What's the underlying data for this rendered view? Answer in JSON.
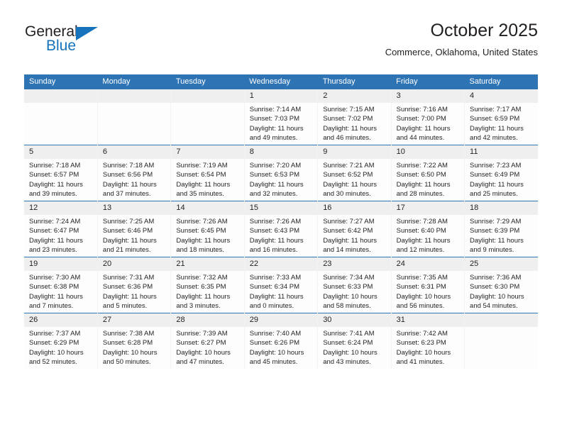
{
  "brand": {
    "name_top": "General",
    "name_bottom": "Blue",
    "triangle_icon": "brand-triangle-icon",
    "accent_color": "#1673bb"
  },
  "header": {
    "title": "October 2025",
    "location": "Commerce, Oklahoma, United States"
  },
  "theme": {
    "header_blue": "#2e74b5",
    "daynum_band": "#efefef",
    "text": "#231f20"
  },
  "calendar": {
    "weekday_headers": [
      "Sunday",
      "Monday",
      "Tuesday",
      "Wednesday",
      "Thursday",
      "Friday",
      "Saturday"
    ],
    "labels": {
      "sunrise": "Sunrise:",
      "sunset": "Sunset:",
      "daylight": "Daylight:"
    },
    "weeks": [
      [
        {
          "day": "",
          "sunrise": "",
          "sunset": "",
          "daylight": ""
        },
        {
          "day": "",
          "sunrise": "",
          "sunset": "",
          "daylight": ""
        },
        {
          "day": "",
          "sunrise": "",
          "sunset": "",
          "daylight": ""
        },
        {
          "day": "1",
          "sunrise": "Sunrise: 7:14 AM",
          "sunset": "Sunset: 7:03 PM",
          "daylight": "Daylight: 11 hours and 49 minutes."
        },
        {
          "day": "2",
          "sunrise": "Sunrise: 7:15 AM",
          "sunset": "Sunset: 7:02 PM",
          "daylight": "Daylight: 11 hours and 46 minutes."
        },
        {
          "day": "3",
          "sunrise": "Sunrise: 7:16 AM",
          "sunset": "Sunset: 7:00 PM",
          "daylight": "Daylight: 11 hours and 44 minutes."
        },
        {
          "day": "4",
          "sunrise": "Sunrise: 7:17 AM",
          "sunset": "Sunset: 6:59 PM",
          "daylight": "Daylight: 11 hours and 42 minutes."
        }
      ],
      [
        {
          "day": "5",
          "sunrise": "Sunrise: 7:18 AM",
          "sunset": "Sunset: 6:57 PM",
          "daylight": "Daylight: 11 hours and 39 minutes."
        },
        {
          "day": "6",
          "sunrise": "Sunrise: 7:18 AM",
          "sunset": "Sunset: 6:56 PM",
          "daylight": "Daylight: 11 hours and 37 minutes."
        },
        {
          "day": "7",
          "sunrise": "Sunrise: 7:19 AM",
          "sunset": "Sunset: 6:54 PM",
          "daylight": "Daylight: 11 hours and 35 minutes."
        },
        {
          "day": "8",
          "sunrise": "Sunrise: 7:20 AM",
          "sunset": "Sunset: 6:53 PM",
          "daylight": "Daylight: 11 hours and 32 minutes."
        },
        {
          "day": "9",
          "sunrise": "Sunrise: 7:21 AM",
          "sunset": "Sunset: 6:52 PM",
          "daylight": "Daylight: 11 hours and 30 minutes."
        },
        {
          "day": "10",
          "sunrise": "Sunrise: 7:22 AM",
          "sunset": "Sunset: 6:50 PM",
          "daylight": "Daylight: 11 hours and 28 minutes."
        },
        {
          "day": "11",
          "sunrise": "Sunrise: 7:23 AM",
          "sunset": "Sunset: 6:49 PM",
          "daylight": "Daylight: 11 hours and 25 minutes."
        }
      ],
      [
        {
          "day": "12",
          "sunrise": "Sunrise: 7:24 AM",
          "sunset": "Sunset: 6:47 PM",
          "daylight": "Daylight: 11 hours and 23 minutes."
        },
        {
          "day": "13",
          "sunrise": "Sunrise: 7:25 AM",
          "sunset": "Sunset: 6:46 PM",
          "daylight": "Daylight: 11 hours and 21 minutes."
        },
        {
          "day": "14",
          "sunrise": "Sunrise: 7:26 AM",
          "sunset": "Sunset: 6:45 PM",
          "daylight": "Daylight: 11 hours and 18 minutes."
        },
        {
          "day": "15",
          "sunrise": "Sunrise: 7:26 AM",
          "sunset": "Sunset: 6:43 PM",
          "daylight": "Daylight: 11 hours and 16 minutes."
        },
        {
          "day": "16",
          "sunrise": "Sunrise: 7:27 AM",
          "sunset": "Sunset: 6:42 PM",
          "daylight": "Daylight: 11 hours and 14 minutes."
        },
        {
          "day": "17",
          "sunrise": "Sunrise: 7:28 AM",
          "sunset": "Sunset: 6:40 PM",
          "daylight": "Daylight: 11 hours and 12 minutes."
        },
        {
          "day": "18",
          "sunrise": "Sunrise: 7:29 AM",
          "sunset": "Sunset: 6:39 PM",
          "daylight": "Daylight: 11 hours and 9 minutes."
        }
      ],
      [
        {
          "day": "19",
          "sunrise": "Sunrise: 7:30 AM",
          "sunset": "Sunset: 6:38 PM",
          "daylight": "Daylight: 11 hours and 7 minutes."
        },
        {
          "day": "20",
          "sunrise": "Sunrise: 7:31 AM",
          "sunset": "Sunset: 6:36 PM",
          "daylight": "Daylight: 11 hours and 5 minutes."
        },
        {
          "day": "21",
          "sunrise": "Sunrise: 7:32 AM",
          "sunset": "Sunset: 6:35 PM",
          "daylight": "Daylight: 11 hours and 3 minutes."
        },
        {
          "day": "22",
          "sunrise": "Sunrise: 7:33 AM",
          "sunset": "Sunset: 6:34 PM",
          "daylight": "Daylight: 11 hours and 0 minutes."
        },
        {
          "day": "23",
          "sunrise": "Sunrise: 7:34 AM",
          "sunset": "Sunset: 6:33 PM",
          "daylight": "Daylight: 10 hours and 58 minutes."
        },
        {
          "day": "24",
          "sunrise": "Sunrise: 7:35 AM",
          "sunset": "Sunset: 6:31 PM",
          "daylight": "Daylight: 10 hours and 56 minutes."
        },
        {
          "day": "25",
          "sunrise": "Sunrise: 7:36 AM",
          "sunset": "Sunset: 6:30 PM",
          "daylight": "Daylight: 10 hours and 54 minutes."
        }
      ],
      [
        {
          "day": "26",
          "sunrise": "Sunrise: 7:37 AM",
          "sunset": "Sunset: 6:29 PM",
          "daylight": "Daylight: 10 hours and 52 minutes."
        },
        {
          "day": "27",
          "sunrise": "Sunrise: 7:38 AM",
          "sunset": "Sunset: 6:28 PM",
          "daylight": "Daylight: 10 hours and 50 minutes."
        },
        {
          "day": "28",
          "sunrise": "Sunrise: 7:39 AM",
          "sunset": "Sunset: 6:27 PM",
          "daylight": "Daylight: 10 hours and 47 minutes."
        },
        {
          "day": "29",
          "sunrise": "Sunrise: 7:40 AM",
          "sunset": "Sunset: 6:26 PM",
          "daylight": "Daylight: 10 hours and 45 minutes."
        },
        {
          "day": "30",
          "sunrise": "Sunrise: 7:41 AM",
          "sunset": "Sunset: 6:24 PM",
          "daylight": "Daylight: 10 hours and 43 minutes."
        },
        {
          "day": "31",
          "sunrise": "Sunrise: 7:42 AM",
          "sunset": "Sunset: 6:23 PM",
          "daylight": "Daylight: 10 hours and 41 minutes."
        },
        {
          "day": "",
          "sunrise": "",
          "sunset": "",
          "daylight": ""
        }
      ]
    ]
  }
}
